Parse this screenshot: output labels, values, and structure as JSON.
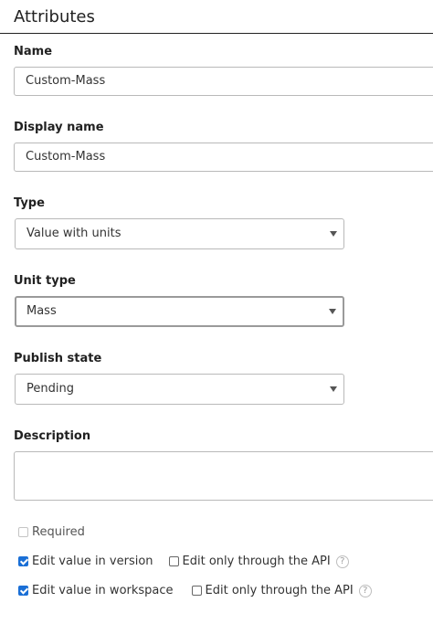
{
  "panel": {
    "title": "Attributes"
  },
  "name": {
    "label": "Name",
    "value": "Custom-Mass"
  },
  "display_name": {
    "label": "Display name",
    "value": "Custom-Mass"
  },
  "type": {
    "label": "Type",
    "selected": "Value with units"
  },
  "unit_type": {
    "label": "Unit type",
    "selected": "Mass"
  },
  "publish_state": {
    "label": "Publish state",
    "selected": "Pending"
  },
  "description": {
    "label": "Description",
    "value": ""
  },
  "options": {
    "required": {
      "label": "Required",
      "checked": false,
      "disabled": true
    },
    "edit_in_version": {
      "label": "Edit value in version",
      "checked": true
    },
    "version_api_only": {
      "label": "Edit only through the API",
      "checked": false
    },
    "edit_in_workspace": {
      "label": "Edit value in workspace",
      "checked": true
    },
    "workspace_api_only": {
      "label": "Edit only through the API",
      "checked": false
    },
    "help_glyph": "?"
  },
  "icons": {
    "dropdown": "chevron-down-icon",
    "help": "help-icon"
  },
  "colors": {
    "checkbox_checked": "#1a6fd6",
    "border": "#b9b9b9",
    "title_rule": "#222222"
  }
}
